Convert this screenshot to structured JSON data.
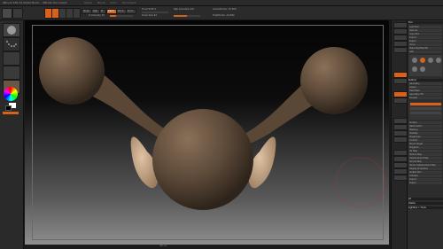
{
  "app": {
    "title": "ZBrush 4R5 64 bit/bit Build ... ZBrush Document",
    "menu": [
      "Alpha",
      "Brush",
      "Color",
      "Document",
      "Draw",
      "Edit",
      "File",
      "Layer",
      "Light",
      "Macro",
      "Marker",
      "Material",
      "Movie",
      "Picker",
      "Preferences",
      "Render",
      "Stencil",
      "Stroke",
      "Texture",
      "Tool",
      "Transform",
      "Zplugin",
      "Zscript"
    ]
  },
  "toolbar": {
    "mode_buttons": [
      "Edit",
      "Draw",
      "Move",
      "Scale",
      "Rotate"
    ],
    "rgb_label": "Rgb",
    "mrgb_label": "Mrgb",
    "m_label": "M",
    "zadd_label": "Zadd",
    "zsub_label": "Zsub",
    "zcut_label": "Zcut",
    "focal_shift": "Focal Shift 0",
    "draw_size": "Draw Size 64",
    "z_intensity": "Z Intensity 25",
    "rgb_intensity": "Rgb Intensity 100",
    "active_points": "ActivePoints: 15,360",
    "total_points": "TotalPoints: 24,582",
    "z_intensity_level": 0.25,
    "draw_size_level": 0.5
  },
  "right_panel": {
    "header": "Tool",
    "rows": [
      "Load Tool",
      "Save As",
      "Copy Tool",
      "Import",
      "Export",
      "Clone",
      "Make PolyMesh3D",
      "GoZ",
      "All",
      "Visible",
      "Lightbox > Tools",
      "Subtool",
      "Geometry",
      "Layers",
      "FiberMesh",
      "Geometry HD",
      "Preview",
      "Surface",
      "Deformation",
      "Masking",
      "Visibility",
      "Polygroups",
      "Contact",
      "Morph Target",
      "Polypaint",
      "UV Map",
      "Texture Map",
      "Displacement Map",
      "Normal Map",
      "Vector Displacement Map",
      "Display Properties",
      "Unified Skin",
      "Initialize",
      "Import",
      "Export"
    ]
  },
  "status": "ZBrush"
}
